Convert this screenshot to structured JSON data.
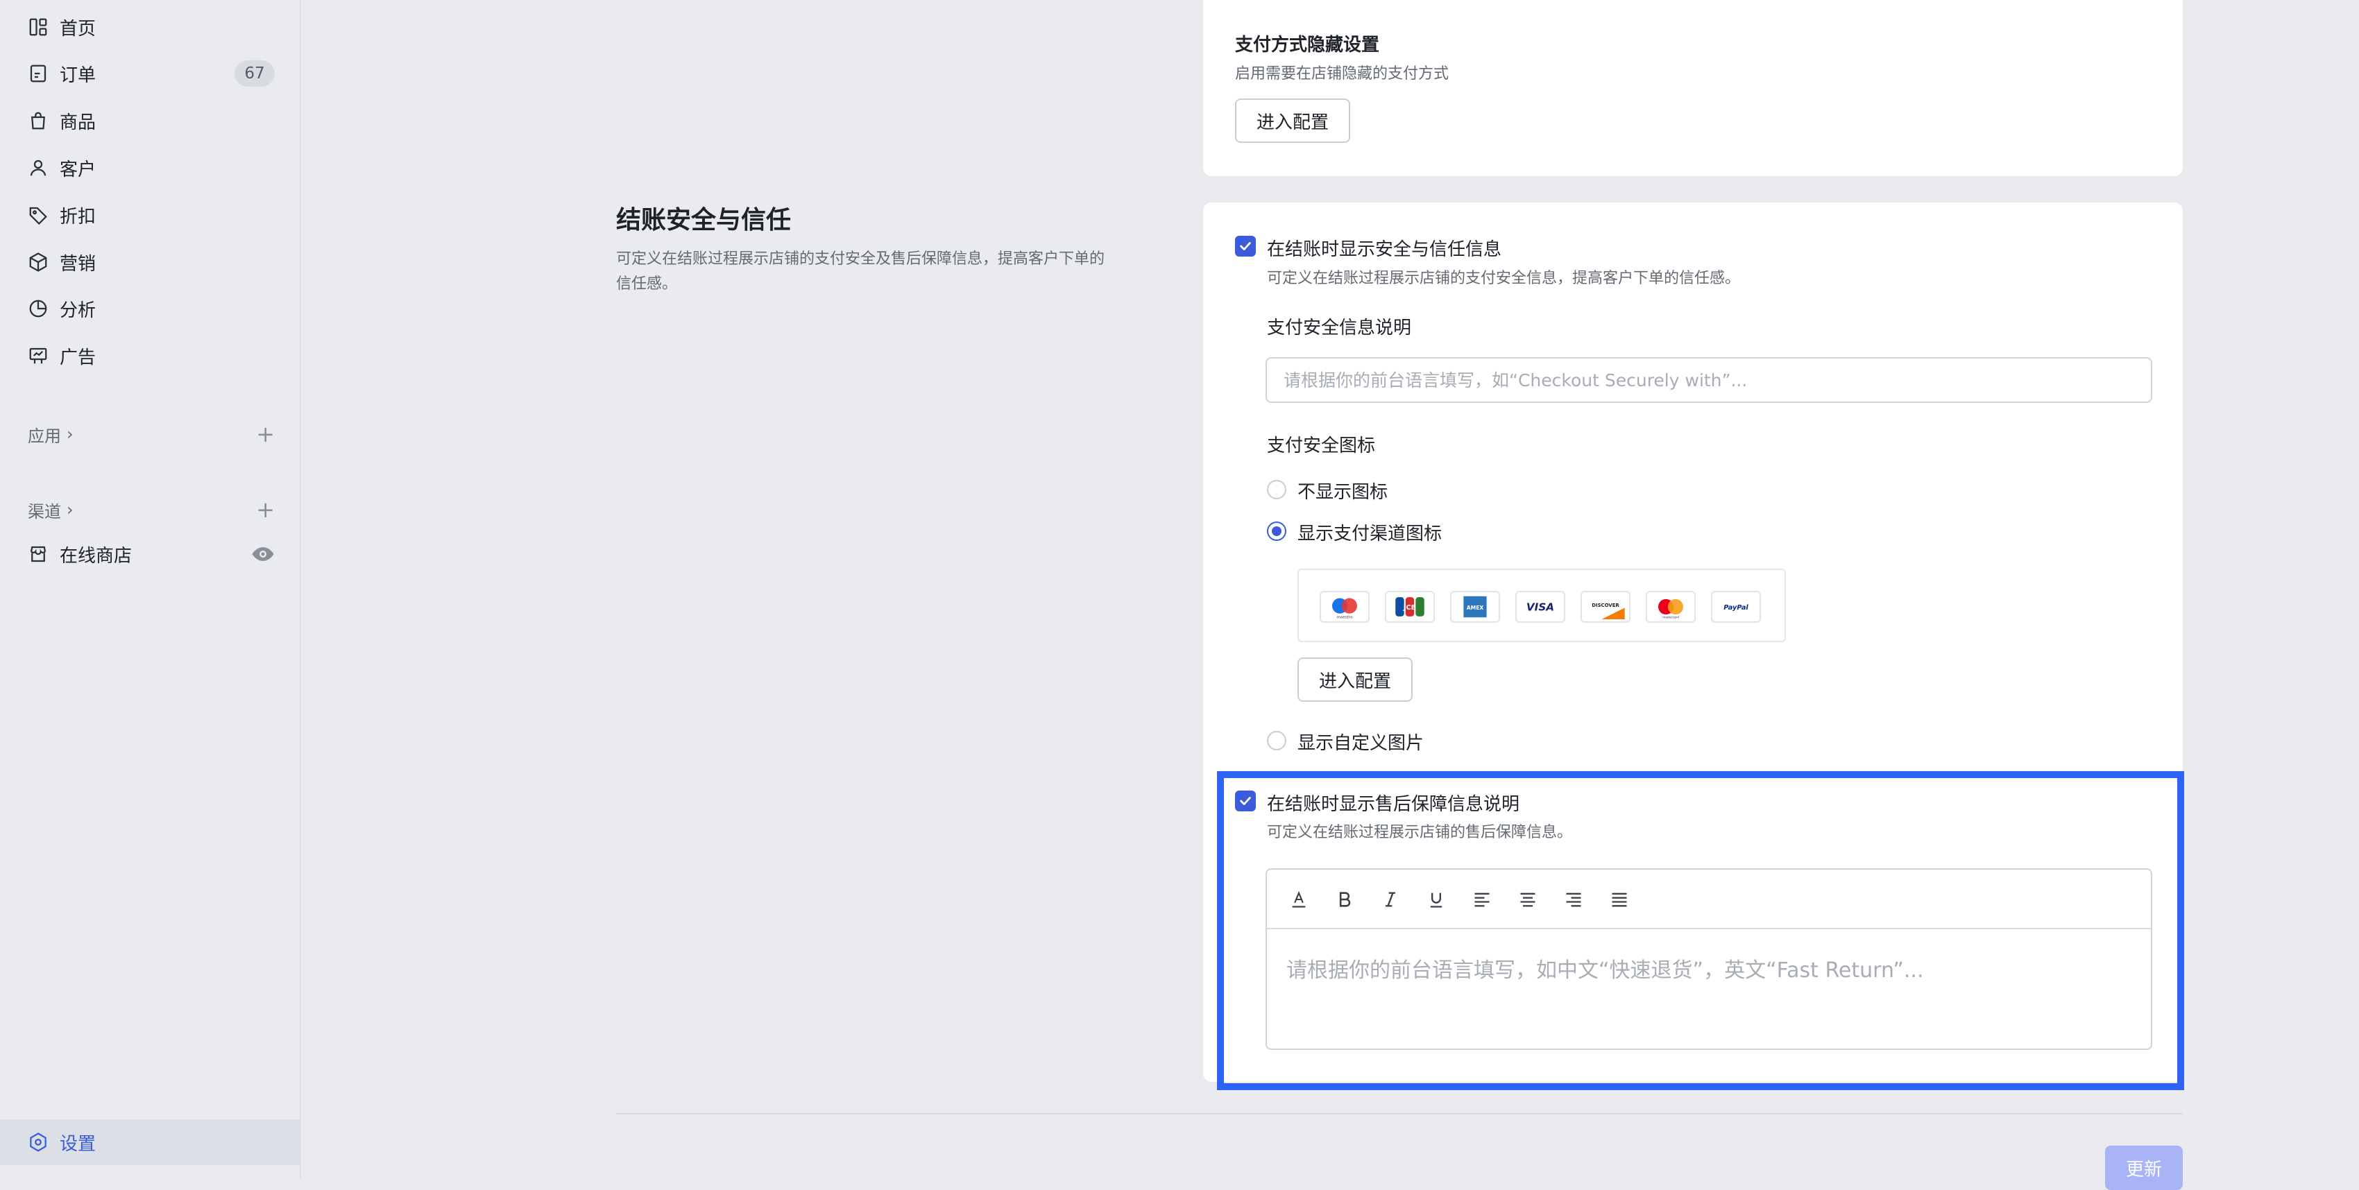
{
  "sidebar": {
    "items": [
      {
        "label": "首页",
        "icon": "dashboard-icon"
      },
      {
        "label": "订单",
        "icon": "order-icon",
        "badge": "67"
      },
      {
        "label": "商品",
        "icon": "bag-icon"
      },
      {
        "label": "客户",
        "icon": "user-icon"
      },
      {
        "label": "折扣",
        "icon": "tag-icon"
      },
      {
        "label": "营销",
        "icon": "cube-icon"
      },
      {
        "label": "分析",
        "icon": "pie-chart-icon"
      },
      {
        "label": "广告",
        "icon": "billboard-icon"
      }
    ],
    "apps_label": "应用",
    "channels_label": "渠道",
    "store_label": "在线商店",
    "settings_label": "设置"
  },
  "hidden_payment": {
    "title": "支付方式隐藏设置",
    "desc": "启用需要在店铺隐藏的支付方式",
    "button": "进入配置"
  },
  "trust": {
    "section_title": "结账安全与信任",
    "section_desc": "可定义在结账过程展示店铺的支付安全及售后保障信息，提高客户下单的信任感。",
    "show_security_label": "在结账时显示安全与信任信息",
    "show_security_desc": "可定义在结账过程展示店铺的支付安全信息，提高客户下单的信任感。",
    "security_text_label": "支付安全信息说明",
    "security_text_placeholder": "请根据你的前台语言填写，如“Checkout Securely with”...",
    "security_icon_label": "支付安全图标",
    "radio_none": "不显示图标",
    "radio_channel": "显示支付渠道图标",
    "radio_custom": "显示自定义图片",
    "payment_icons": [
      "maestro",
      "JCB",
      "AMEX",
      "VISA",
      "DISCOVER",
      "mastercard",
      "PayPal"
    ],
    "config_button": "进入配置",
    "show_aftersale_label": "在结账时显示售后保障信息说明",
    "show_aftersale_desc": "可定义在结账过程展示店铺的售后保障信息。",
    "editor_placeholder": "请根据你的前台语言填写，如中文“快速退货”，英文“Fast Return”..."
  },
  "footer": {
    "update_button": "更新"
  },
  "colors": {
    "accent": "#3b5bdb",
    "highlight": "#2f63f5",
    "background": "#e9ebef"
  }
}
